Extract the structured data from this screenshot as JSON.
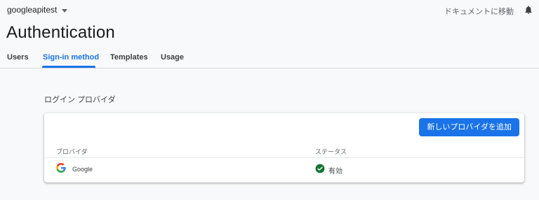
{
  "header": {
    "project_name": "googleapitest",
    "docs_link": "ドキュメントに移動"
  },
  "page": {
    "title": "Authentication"
  },
  "tabs": [
    {
      "label": "Users",
      "active": false
    },
    {
      "label": "Sign-in method",
      "active": true
    },
    {
      "label": "Templates",
      "active": false
    },
    {
      "label": "Usage",
      "active": false
    }
  ],
  "providers_section": {
    "heading": "ログイン プロバイダ",
    "add_button": "新しいプロバイダを追加",
    "columns": {
      "provider": "プロバイダ",
      "status": "ステータス"
    },
    "rows": [
      {
        "provider": "Google",
        "status": "有効",
        "icon": "google-logo-icon",
        "status_icon": "check-circle-icon"
      }
    ]
  },
  "colors": {
    "accent": "#1a73e8",
    "status_enabled": "#137333",
    "background": "#f8f9fa"
  }
}
